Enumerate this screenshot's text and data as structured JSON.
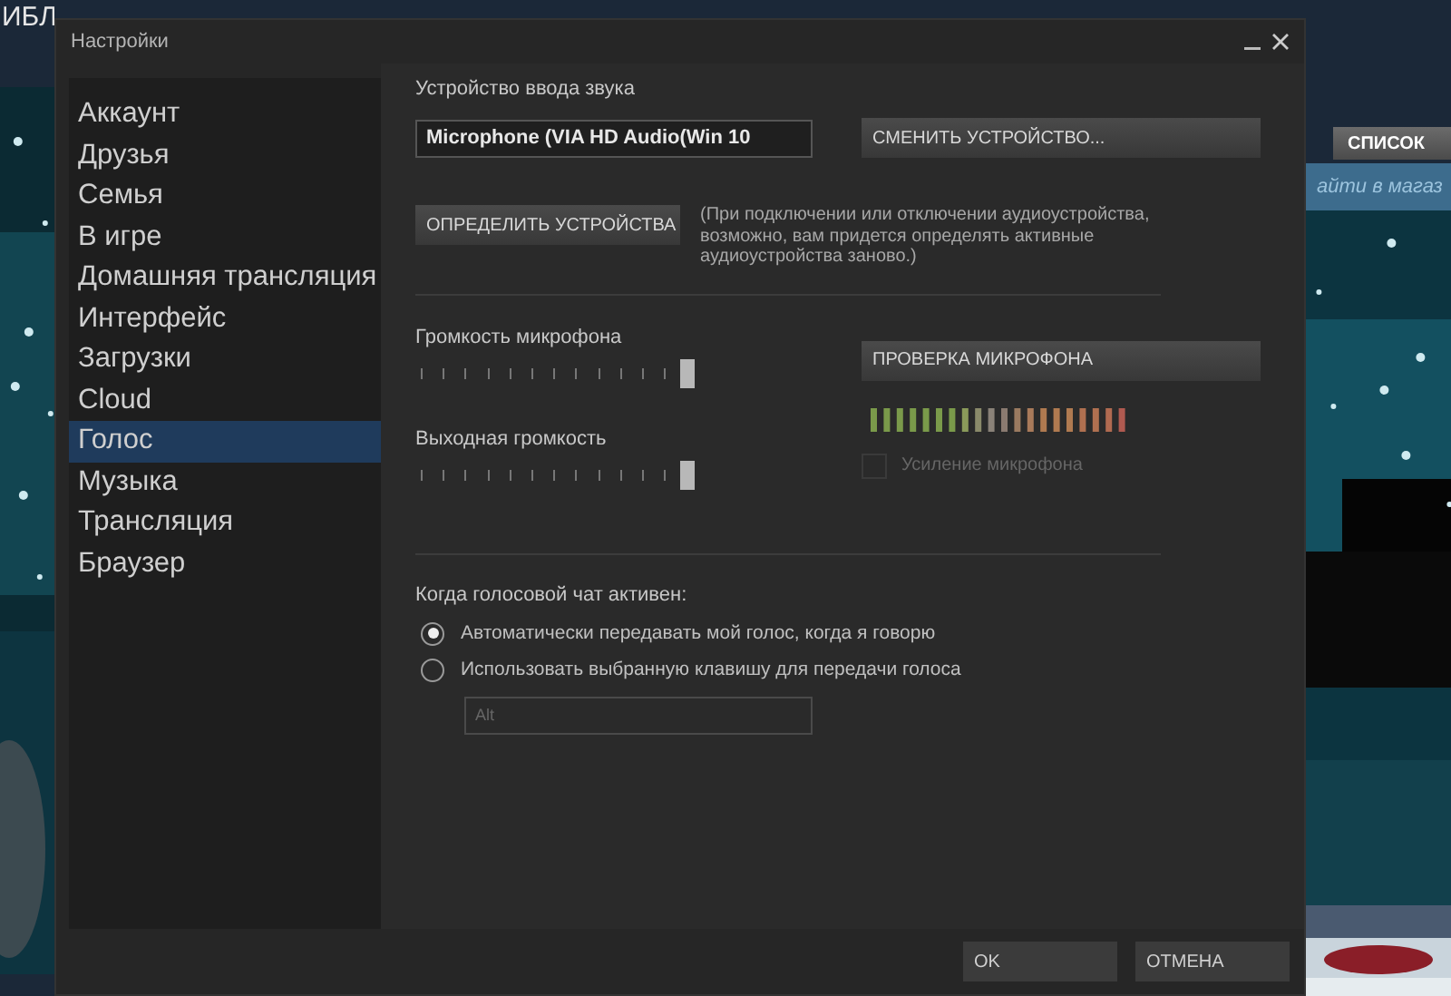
{
  "background": {
    "nav_text": "ИБЛ",
    "list_button": "СПИСОК",
    "search": {
      "placeholder": "айти в магаз"
    }
  },
  "window": {
    "title": "Настройки"
  },
  "sidebar": {
    "items": [
      {
        "label": "Аккаунт",
        "selected": false
      },
      {
        "label": "Друзья",
        "selected": false
      },
      {
        "label": "Семья",
        "selected": false
      },
      {
        "label": "В игре",
        "selected": false
      },
      {
        "label": "Домашняя трансляция",
        "selected": false
      },
      {
        "label": "Интерфейс",
        "selected": false
      },
      {
        "label": "Загрузки",
        "selected": false
      },
      {
        "label": "Cloud",
        "selected": false
      },
      {
        "label": "Голос",
        "selected": true
      },
      {
        "label": "Музыка",
        "selected": false
      },
      {
        "label": "Трансляция",
        "selected": false
      },
      {
        "label": "Браузер",
        "selected": false
      }
    ]
  },
  "input_device": {
    "label": "Устройство ввода звука",
    "value": "Microphone (VIA HD Audio(Win 10",
    "change_button": "СМЕНИТЬ УСТРОЙСТВО..."
  },
  "detect": {
    "button": "ОПРЕДЕЛИТЬ УСТРОЙСТВА",
    "note": "(При подключении или отключении аудиоустройства, возможно, вам придется определять активные аудиоустройства заново.)"
  },
  "sliders": [
    {
      "label": "Громкость микрофона",
      "level": 1
    },
    {
      "label": "Выходная громкость",
      "level": 1
    }
  ],
  "test_button": "ПРОВЕРКА МИКРОФОНА",
  "boost": {
    "label": "Усиление микрофона",
    "checked": false,
    "disabled": true
  },
  "voice_mode": {
    "label": "Когда голосовой чат активен:",
    "options": [
      {
        "label": "Автоматически передавать мой голос, когда я говорю",
        "selected": true
      },
      {
        "label": "Использовать выбранную клавишу для передачи голоса",
        "selected": false
      }
    ],
    "key": {
      "value": "Alt",
      "disabled": true
    }
  },
  "buttons": [
    "OK",
    "ОТМЕНА"
  ]
}
